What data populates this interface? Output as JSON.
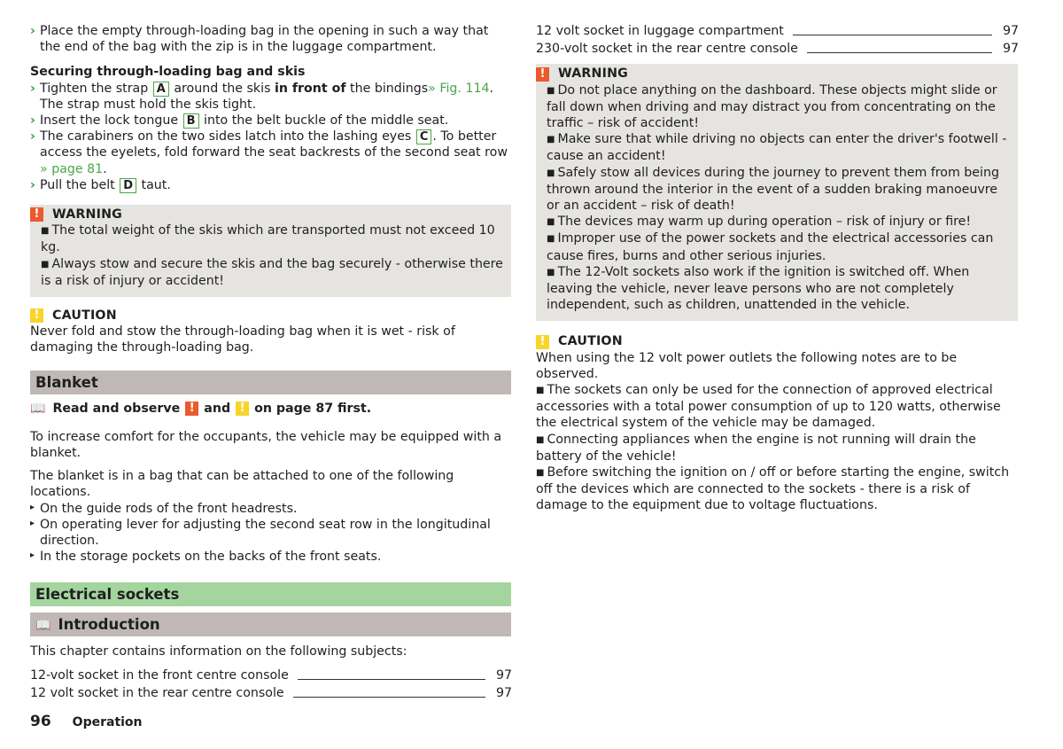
{
  "left": {
    "intro_step": "Place the empty through-loading bag in the opening in such a way that the end of the bag with the zip is in the luggage compartment.",
    "subheading": "Securing through-loading bag and skis",
    "steps": [
      {
        "pre": "Tighten the strap ",
        "letter": "A",
        "mid": " around the skis ",
        "bold": "in front of",
        "post": " the bindings",
        "link": "» Fig. 114",
        "tail": ". The strap must hold the skis tight."
      },
      {
        "pre": "Insert the lock tongue ",
        "letter": "B",
        "post": " into the belt buckle of the middle seat."
      },
      {
        "pre": "The carabiners on the two sides latch into the lashing eyes ",
        "letter": "C",
        "post": ". To better access the eyelets, fold forward the seat backrests of the second seat row ",
        "link": "» page 81",
        "tail": "."
      },
      {
        "pre": "Pull the belt ",
        "letter": "D",
        "post": " taut."
      }
    ],
    "warning": {
      "title": "WARNING",
      "icon": "exclamation-icon",
      "items": [
        "The total weight of the skis which are transported must not exceed 10 kg.",
        "Always stow and secure the skis and the bag securely - otherwise there is a risk of injury or accident!"
      ]
    },
    "caution": {
      "title": "CAUTION",
      "icon": "exclamation-icon",
      "text": "Never fold and stow the through-loading bag when it is wet - risk of damaging the through-loading bag."
    },
    "blanket": {
      "heading": "Blanket",
      "read_pre": "Read and observe",
      "read_and": "and",
      "read_post": "on page 87 first.",
      "para1": "To increase comfort for the occupants, the vehicle may be equipped with a blanket.",
      "para2": "The blanket is in a bag that can be attached to one of the following locations.",
      "locations": [
        "On the guide rods of the front headrests.",
        "On operating lever for adjusting the second seat row in the longitudinal direction.",
        "In the storage pockets on the backs of the front seats."
      ]
    },
    "electrical": {
      "heading": "Electrical sockets",
      "intro_heading": "Introduction",
      "intro_text": "This chapter contains information on the following subjects:",
      "toc": [
        {
          "label": "12-volt socket in the front centre console",
          "page": "97"
        },
        {
          "label": "12 volt socket in the rear centre console",
          "page": "97"
        }
      ]
    }
  },
  "right": {
    "toc": [
      {
        "label": "12 volt socket in luggage compartment",
        "page": "97"
      },
      {
        "label": "230-volt socket in the rear centre console",
        "page": "97"
      }
    ],
    "warning": {
      "title": "WARNING",
      "items": [
        "Do not place anything on the dashboard. These objects might slide or fall down when driving and may distract you from concentrating on the traffic – risk of accident!",
        "Make sure that while driving no objects can enter the driver's footwell - cause an accident!",
        "Safely stow all devices during the journey to prevent them from being thrown around the interior in the event of a sudden braking manoeuvre or an accident – risk of death!",
        "The devices may warm up during operation – risk of injury or fire!",
        "Improper use of the power sockets and the electrical accessories can cause fires, burns and other serious injuries.",
        "The 12-Volt sockets also work if the ignition is switched off. When leaving the vehicle, never leave persons who are not completely independent, such as children, unattended in the vehicle."
      ]
    },
    "caution": {
      "title": "CAUTION",
      "intro": "When using the 12 volt power outlets the following notes are to be observed.",
      "items": [
        "The sockets can only be used for the connection of approved electrical accessories with a total power consumption of up to 120 watts, otherwise the electrical system of the vehicle may be damaged.",
        "Connecting appliances when the engine is not running will drain the battery of the vehicle!",
        "Before switching the ignition on / off or before starting the engine, switch off the devices which are connected to the sockets - there is a risk of damage to the equipment due to voltage fluctuations."
      ]
    }
  },
  "footer": {
    "page_number": "96",
    "section": "Operation"
  },
  "colors": {
    "warning": "#ea5a2c",
    "caution": "#f7d52a",
    "link": "#4aa64a",
    "notice_bg": "#e5e4e1",
    "section_gray": "#bfb8b6",
    "section_green": "#a4d59e"
  }
}
